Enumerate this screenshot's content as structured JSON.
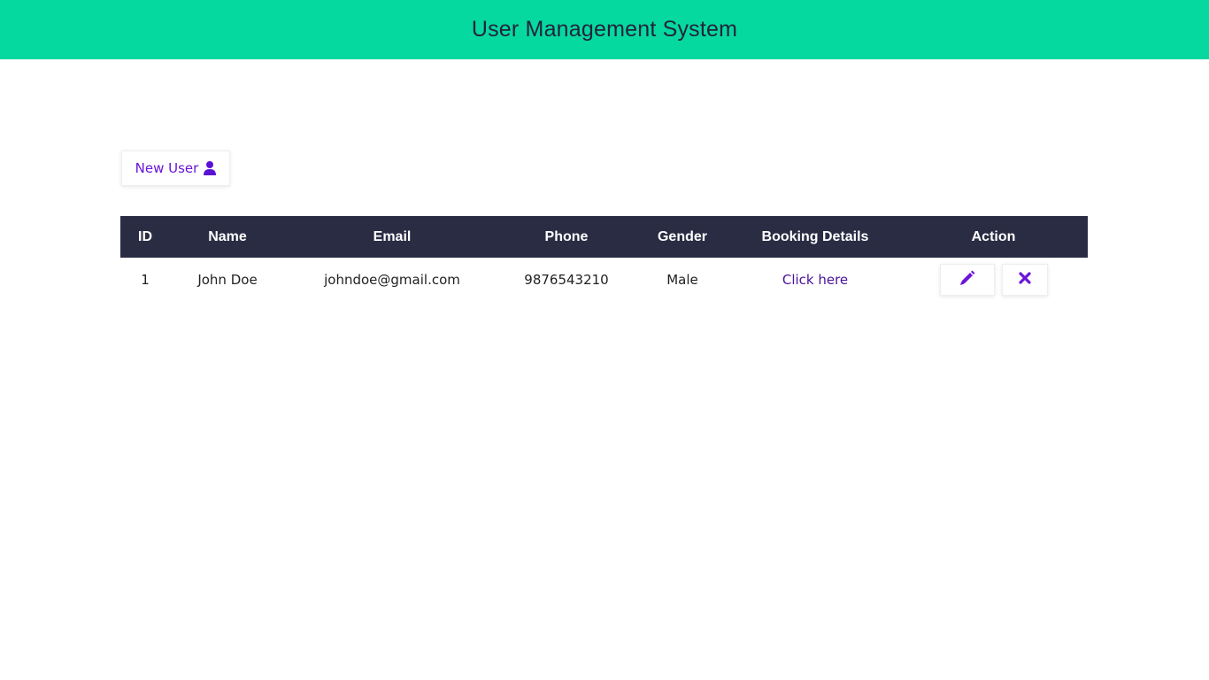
{
  "header": {
    "title": "User Management System"
  },
  "toolbar": {
    "new_user_label": "New User",
    "new_user_icon": "user-icon"
  },
  "colors": {
    "header_bg": "#06d9a0",
    "table_header_bg": "#2a2c44",
    "accent": "#6a15d9",
    "link": "#4b119a"
  },
  "table": {
    "columns": [
      "ID",
      "Name",
      "Email",
      "Phone",
      "Gender",
      "Booking Details",
      "Action"
    ],
    "rows": [
      {
        "id": "1",
        "name": "John Doe",
        "email": "johndoe@gmail.com",
        "phone": "9876543210",
        "gender": "Male",
        "booking_details": "Click here",
        "edit_icon": "pencil-icon",
        "delete_icon": "close-icon"
      }
    ]
  }
}
